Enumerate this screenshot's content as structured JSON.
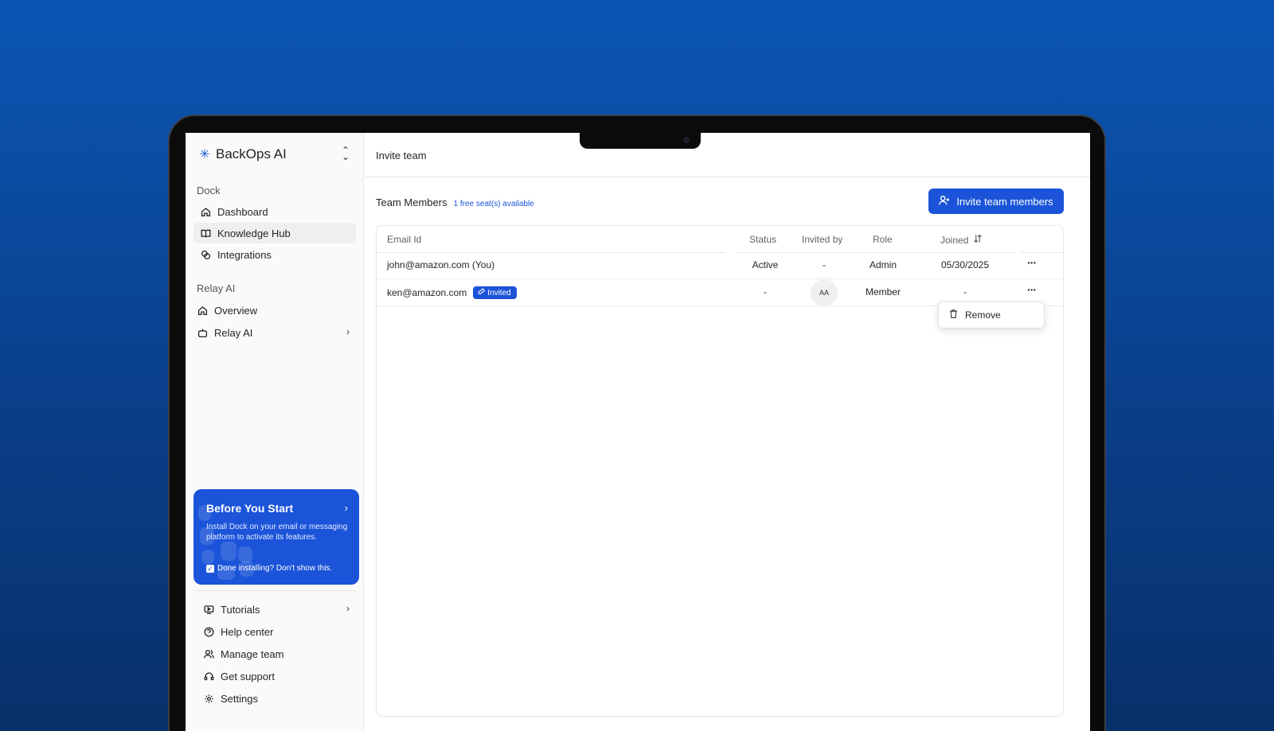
{
  "brand": {
    "name": "BackOps AI"
  },
  "sidebar": {
    "dock_label": "Dock",
    "dock_items": [
      {
        "label": "Dashboard",
        "icon": "home-icon"
      },
      {
        "label": "Knowledge Hub",
        "icon": "book-icon",
        "active": true
      },
      {
        "label": "Integrations",
        "icon": "link-icon"
      }
    ],
    "relay_label": "Relay AI",
    "relay_items": [
      {
        "label": "Overview",
        "icon": "home-icon"
      },
      {
        "label": "Relay AI",
        "icon": "bot-icon",
        "has_chevron": true
      }
    ],
    "promo": {
      "title": "Before You Start",
      "text": "Install Dock on your email or messaging platform to activate its features.",
      "checkbox_label": "Done installing? Don't show this."
    },
    "footer_items": [
      {
        "label": "Tutorials",
        "icon": "play-screen-icon",
        "has_chevron": true
      },
      {
        "label": "Help center",
        "icon": "question-icon"
      },
      {
        "label": "Manage team",
        "icon": "users-icon"
      },
      {
        "label": "Get support",
        "icon": "headset-icon"
      },
      {
        "label": "Settings",
        "icon": "gear-icon"
      }
    ]
  },
  "header": {
    "title": "Invite team"
  },
  "team": {
    "title": "Team Members",
    "seats": "1 free seat(s) available",
    "invite_button": "Invite team members",
    "columns": [
      "Email Id",
      "Status",
      "Invited by",
      "Role",
      "Joined"
    ],
    "rows": [
      {
        "email": "john@amazon.com (You)",
        "badge": "",
        "status": "Active",
        "invited_by": "-",
        "role": "Admin",
        "joined": "05/30/2025"
      },
      {
        "email": "ken@amazon.com",
        "badge": "Invited",
        "status": "-",
        "invited_by": "AA",
        "role": "Member",
        "joined": "-"
      }
    ],
    "row_menu": {
      "remove_label": "Remove"
    }
  },
  "colors": {
    "accent": "#1b54d9",
    "background_top": "#0b56b4",
    "background_bottom": "#08306a"
  }
}
